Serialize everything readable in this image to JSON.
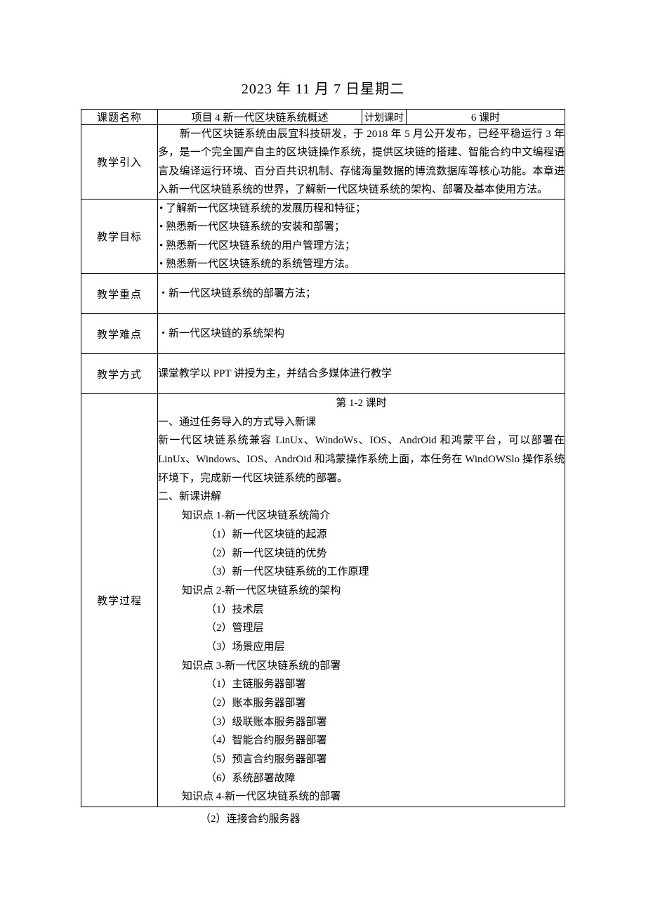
{
  "title": "2023 年 11 月 7 日星期二",
  "header": {
    "topic_label": "课题名称",
    "topic_value": "项目 4 新一代区块链系统概述",
    "plan_label": "计划课时",
    "plan_value": "6 课时"
  },
  "rows": {
    "intro_label": "教学引入",
    "intro_text": "　　新一代区块链系统由辰宜科技研发，于 2018 年 5 月公开发布，已经平稳运行 3 年多，是一个完全国产自主的区块链操作系统，提供区块链的搭建、智能合约中文编程语言及编译运行环境、百分百共识机制、存储海量数据的博流数据库等核心功能。本章进入新一代区块链系统的世界，了解新一代区块链系统的架构、部署及基本使用方法。",
    "goal_label": "教学目标",
    "goal_items": [
      "•  了解新一代区块链系统的发展历程和特征；",
      "•  熟悉新一代区块链系统的安装和部署；",
      "•  熟悉新一代区块链系统的用户管理方法；",
      "•  熟悉新一代区块链系统的系统管理方法。"
    ],
    "focus_label": "教学重点",
    "focus_text": "・新一代区块链系统的部署方法；",
    "difficulty_label": "教学难点",
    "difficulty_text": "・新一代区块链的系统架构",
    "method_label": "教学方式",
    "method_text": "课堂教学以 PPT 讲授为主，并结合多媒体进行教学",
    "process_label": "教学过程",
    "process": {
      "period": "第 1-2 课时",
      "sec1": "一、通过任务导入的方式导入新课",
      "sec1_text": "新一代区块链系统兼容 LinUx、WindoWs、IOS、AndrOid 和鸿蒙平台，可以部署在 LinUx、Windows、IOS、AndrOid 和鸿蒙操作系统上面，本任务在 WindOWSlo 操作系统环境下，完成新一代区块链系统的部署。",
      "sec2": "二、新课讲解",
      "kp1": "知识点 1-新一代区块链系统简介",
      "kp1_items": [
        "（1）新一代区块链的起源",
        "（2）新一代区块链的优势",
        "（3）新一代区块链系统的工作原理"
      ],
      "kp2": "知识点 2-新一代区块链系统的架构",
      "kp2_items": [
        "（1）技术层",
        "（2）管理层",
        "（3）场景应用层"
      ],
      "kp3": "知识点 3-新一代区块链系统的部署",
      "kp3_items": [
        "（1）主链服务器部署",
        "（2）账本服务器部署",
        "（3）级联账本服务器部署",
        "（4）智能合约服务器部署",
        "（5）预言合约服务器部署",
        "（6）系统部署故障"
      ],
      "kp4": "知识点 4-新一代区块链系统的部署"
    }
  },
  "bottom_line": "（2）连接合约服务器"
}
